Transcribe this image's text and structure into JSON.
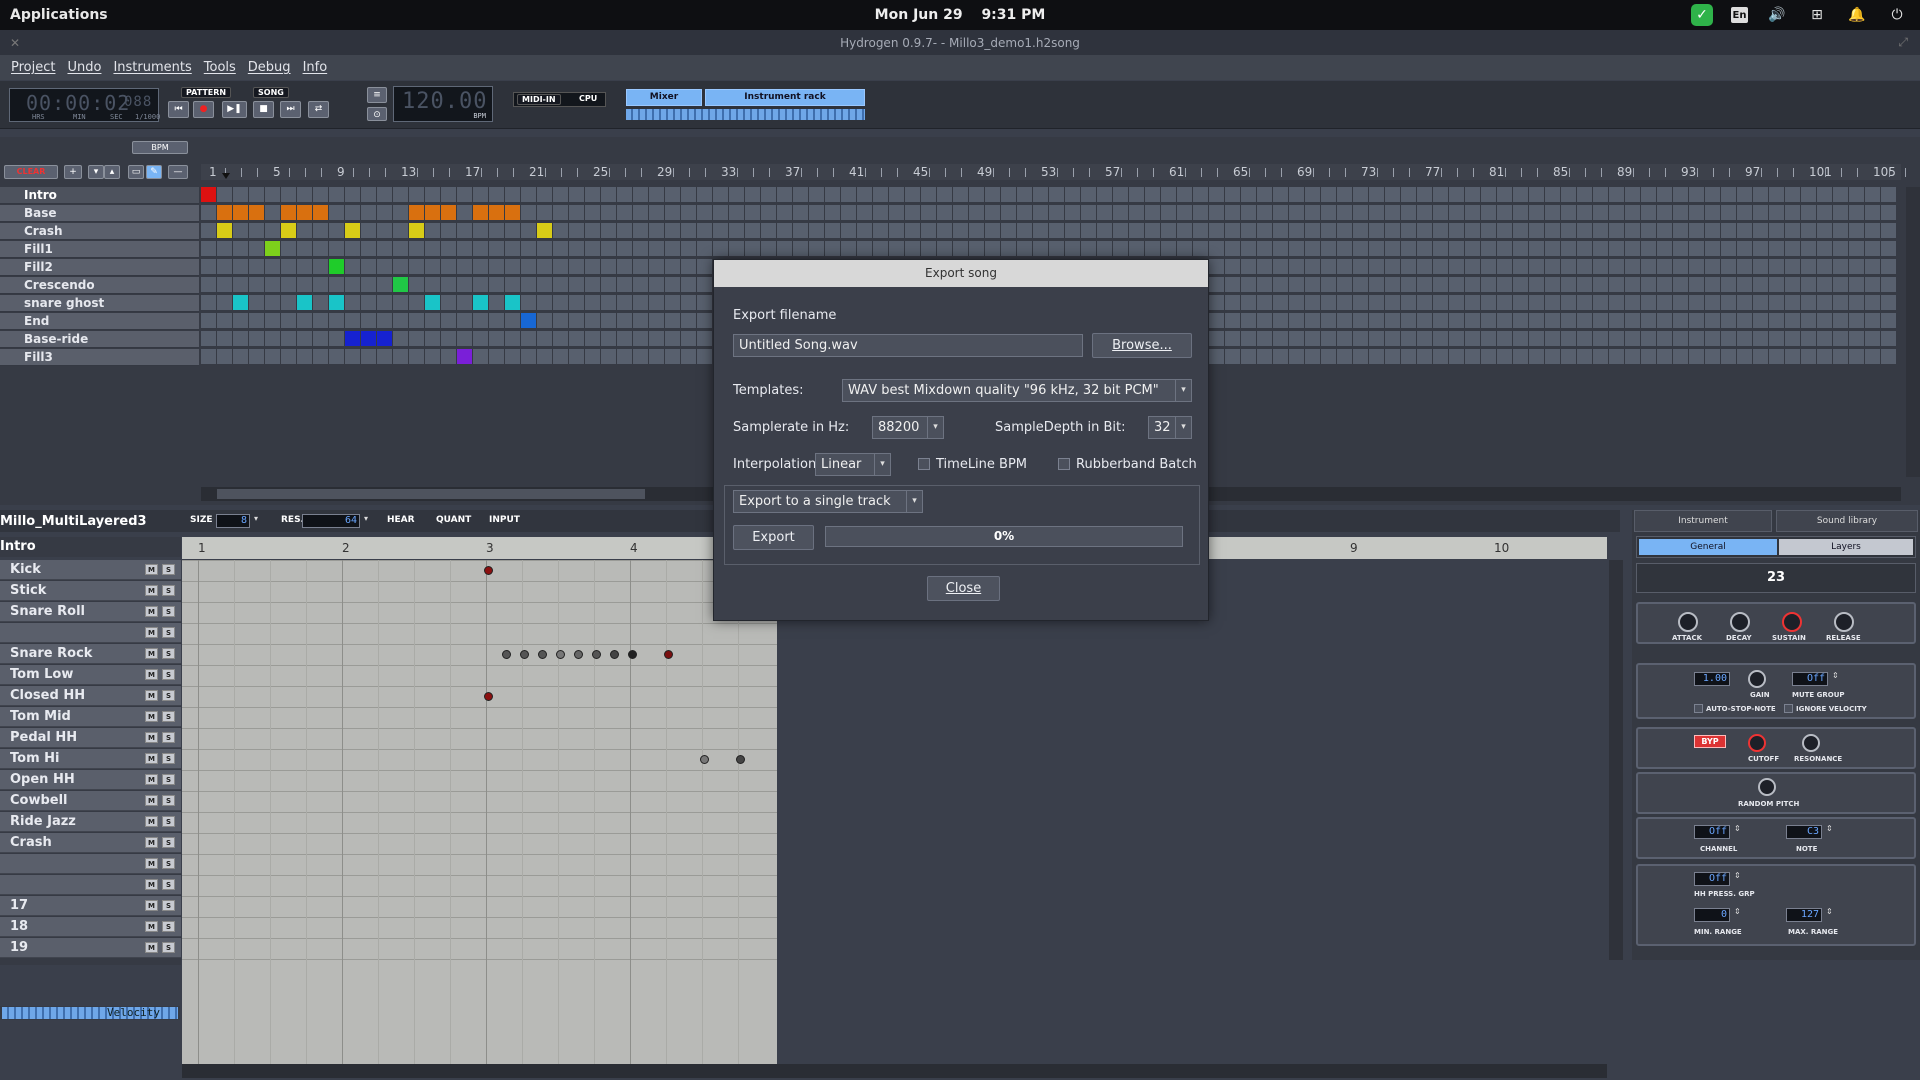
{
  "topbar": {
    "apps": "Applications",
    "date": "Mon Jun 29",
    "time": "9:31 PM",
    "lang": "En"
  },
  "window": {
    "title": "Hydrogen 0.9.7- - Millo3_demo1.h2song"
  },
  "menu": [
    "Project",
    "Undo",
    "Instruments",
    "Tools",
    "Debug",
    "Info"
  ],
  "toolbar": {
    "time": "00:00:02",
    "time_ms": "088",
    "time_units": [
      "HRS",
      "MIN",
      "SEC",
      "1/1000"
    ],
    "pattern_label": "PATTERN",
    "song_label": "SONG",
    "bpm": "120.00",
    "bpm_label": "BPM",
    "midi_in": "MIDI-IN",
    "cpu": "CPU",
    "mixer": "Mixer",
    "instrument_rack": "Instrument rack"
  },
  "song_editor": {
    "bpm_button": "BPM",
    "clear_button": "CLEAR",
    "ruler": [
      "1",
      "5",
      "9",
      "13",
      "17",
      "21",
      "25",
      "29",
      "33",
      "37",
      "41",
      "45",
      "49",
      "53",
      "57",
      "61",
      "65",
      "69",
      "73",
      "77",
      "81",
      "85",
      "89",
      "93",
      "97",
      "101",
      "105"
    ],
    "patterns": [
      "Intro",
      "Base",
      "Crash",
      "Fill1",
      "Fill2",
      "Crescendo",
      "snare ghost",
      "End",
      "Base-ride",
      "Fill3"
    ],
    "colors": {
      "intro": "#dd1111",
      "base": "#d9700f",
      "crash": "#d8cc17",
      "fill1": "#7dd11b",
      "fill2": "#1fcc2a",
      "crescendo": "#20c846",
      "ghost": "#19c4c8",
      "end": "#1767d4",
      "baseride": "#1622d0",
      "fill3": "#7a1fd8"
    }
  },
  "pattern_editor": {
    "pattern_name": "Millo_MultiLayered3",
    "current_pattern": "Intro",
    "size_label": "SIZE",
    "size_value": "8",
    "res_label": "RES.",
    "res_value": "64",
    "hear_label": "HEAR",
    "quant_label": "QUANT",
    "input_label": "INPUT",
    "ruler": [
      "1",
      "2",
      "3",
      "4",
      "9",
      "10"
    ],
    "instruments": [
      "Kick",
      "Stick",
      "Snare Roll",
      "",
      "Snare Rock",
      "Tom Low",
      "Closed HH",
      "Tom Mid",
      "Pedal HH",
      "Tom Hi",
      "Open HH",
      "Cowbell",
      "Ride Jazz",
      "Crash",
      "",
      "",
      "17",
      "18",
      "19"
    ],
    "mute": "M",
    "solo": "S",
    "velocity_label": "Velocity"
  },
  "right_panel": {
    "tab_instrument": "Instrument",
    "tab_sound_library": "Sound library",
    "tab_general": "General",
    "tab_layers": "Layers",
    "instrument_number": "23",
    "knobs": [
      "ATTACK",
      "DECAY",
      "SUSTAIN",
      "RELEASE"
    ],
    "gain_value": "1.00",
    "gain_label": "GAIN",
    "mute_group_value": "Off",
    "mute_group_label": "MUTE GROUP",
    "auto_stop": "AUTO-STOP-NOTE",
    "ignore_velocity": "IGNORE VELOCITY",
    "byp": "BYP",
    "cutoff": "CUTOFF",
    "resonance": "RESONANCE",
    "random_pitch": "RANDOM PITCH",
    "channel_value": "Off",
    "channel_label": "CHANNEL",
    "note_value": "C3",
    "note_label": "NOTE",
    "hh_value": "Off",
    "hh_label": "HH PRESS. GRP",
    "min_range_value": "0",
    "min_range_label": "MIN. RANGE",
    "max_range_value": "127",
    "max_range_label": "MAX. RANGE"
  },
  "dialog": {
    "title": "Export song",
    "filename_label": "Export filename",
    "filename_value": "Untitled Song.wav",
    "browse": "Browse...",
    "templates_label": "Templates:",
    "template_value": "WAV best Mixdown quality \"96 kHz, 32 bit PCM\"",
    "samplerate_label": "Samplerate in Hz:",
    "samplerate_value": "88200",
    "sampledepth_label": "SampleDepth in Bit:",
    "sampledepth_value": "32",
    "interpolation_label": "Interpolation:",
    "interpolation_value": "Linear",
    "timeline_bpm": "TimeLine BPM",
    "rubberband": "Rubberband Batch",
    "export_mode": "Export to a single track",
    "export_button": "Export",
    "progress": "0%",
    "close_button": "Close"
  }
}
